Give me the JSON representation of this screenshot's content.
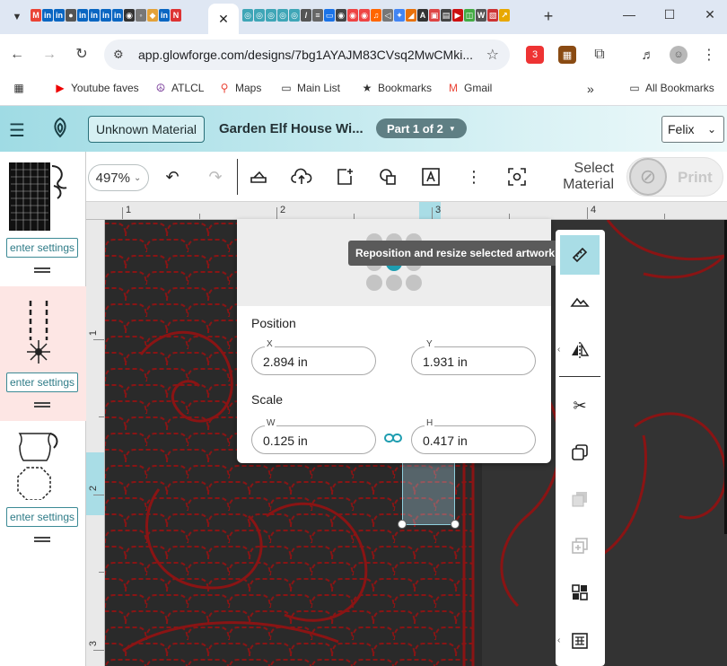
{
  "browser": {
    "url": "app.glowforge.com/designs/7bg1AYAJM83CVsq2MwCMki...",
    "active_tab_close": "✕",
    "new_tab": "+",
    "window_controls": [
      "—",
      "☐",
      "✕"
    ],
    "extension_badge": "3",
    "bookmarks": [
      {
        "label": "Youtube faves",
        "icon": "youtube-icon"
      },
      {
        "label": "ATLCL",
        "icon": "peace-icon"
      },
      {
        "label": "Maps",
        "icon": "maps-pin-icon"
      },
      {
        "label": "Main List",
        "icon": "folder-icon"
      },
      {
        "label": "Bookmarks",
        "icon": "star-icon"
      },
      {
        "label": "Gmail",
        "icon": "gmail-icon"
      }
    ],
    "all_bookmarks": "All Bookmarks",
    "more_bookmarks": "»",
    "colors": {
      "tabstrip": "#dfe7f3",
      "omnibox": "#eef1f6"
    }
  },
  "app": {
    "material_button": "Unknown Material",
    "title": "Garden Elf House Wi...",
    "part_label": "Part 1 of 2",
    "user": "Felix",
    "accent": "#1e9db0"
  },
  "thumbnails": [
    {
      "settings_label": "enter settings",
      "highlighted": false
    },
    {
      "settings_label": "enter settings",
      "highlighted": true
    },
    {
      "settings_label": "enter settings",
      "highlighted": false
    }
  ],
  "toolbar": {
    "zoom": "497%",
    "select_material_line1": "Select",
    "select_material_line2": "Material",
    "print_label": "Print",
    "icons": [
      "undo-icon",
      "redo-icon",
      "engrave-icon",
      "upload-icon",
      "add-artwork-icon",
      "shapes-icon",
      "text-icon",
      "more-icon",
      "snapshot-icon"
    ]
  },
  "rulers": {
    "top_numbers": [
      "1",
      "2",
      "3",
      "4"
    ],
    "left_numbers": [
      "1",
      "2",
      "3"
    ]
  },
  "reposition_panel": {
    "tooltip": "Reposition and resize selected artwork",
    "position_heading": "Position",
    "x_label": "X",
    "x_value": "2.894 in",
    "y_label": "Y",
    "y_value": "1.931 in",
    "scale_heading": "Scale",
    "w_label": "W",
    "w_value": "0.125 in",
    "h_label": "H",
    "h_value": "0.417 in"
  },
  "right_panel": {
    "items": [
      "ruler-icon",
      "mountain-icon",
      "flip-icon",
      "scissors-icon",
      "duplicate-icon",
      "group-icon",
      "ungroup-icon",
      "arrange-icon",
      "align-icon"
    ]
  }
}
